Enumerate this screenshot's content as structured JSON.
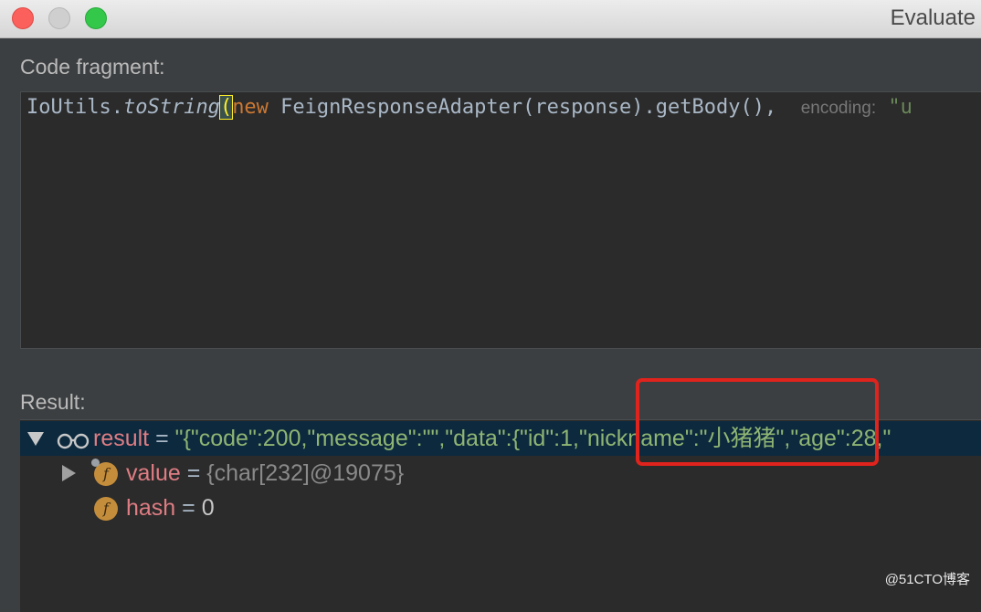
{
  "window": {
    "title": "Evaluate"
  },
  "code_fragment": {
    "label": "Code fragment:",
    "tokens": {
      "t1": "IoUtils.",
      "t2": "toString",
      "t3": "(",
      "t4": "new",
      "t5": " FeignResponseAdapter(response).getBody(), ",
      "hint_label": "encoding:",
      "hint_value": " \"u"
    }
  },
  "result": {
    "label": "Result:",
    "rows": [
      {
        "name": "result",
        "eq": " = ",
        "value": "\"{\"code\":200,\"message\":\"\",\"data\":{\"id\":1,\"nickname\":\"小猪猪\",\"age\":28,\""
      },
      {
        "name": "value",
        "eq": " = ",
        "value": "{char[232]@19075}"
      },
      {
        "name": "hash",
        "eq": " = ",
        "value": "0"
      }
    ]
  },
  "icons": {
    "field_badge": "f"
  },
  "watermark": "@51CTO博客",
  "colors": {
    "background": "#3c3f41",
    "editor_bg": "#2b2b2b",
    "selection": "#0d293e",
    "keyword": "#cc7832",
    "string": "#6a8759",
    "field_name": "#df7d83",
    "annotation_box": "#e0231c"
  }
}
